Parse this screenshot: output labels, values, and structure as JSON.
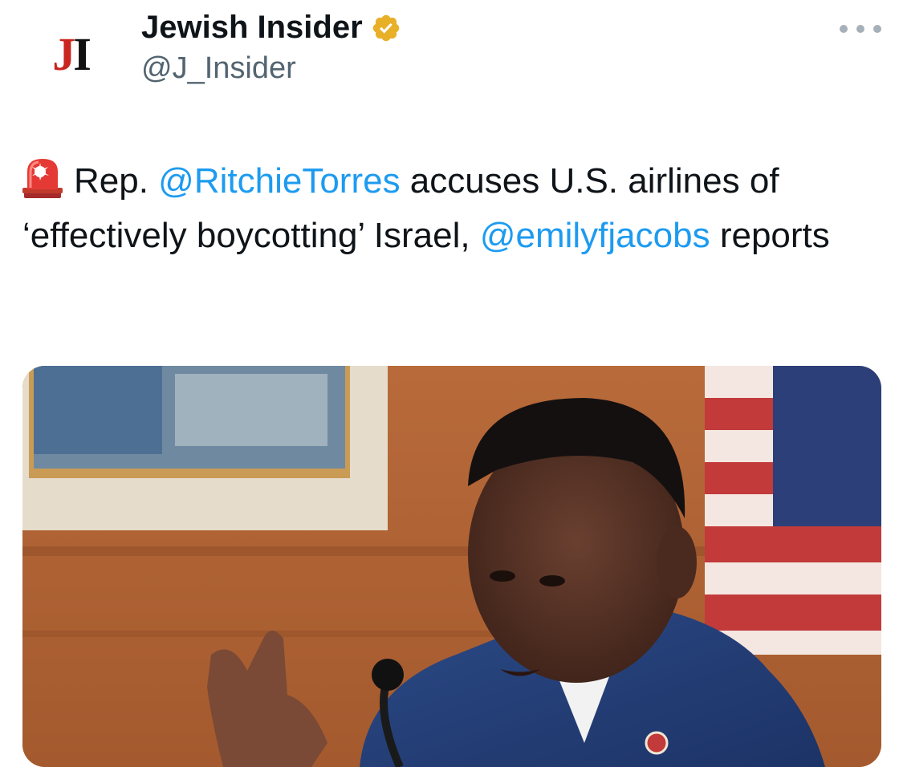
{
  "account": {
    "display_name": "Jewish Insider",
    "handle": "@J_Insider",
    "avatar_logo": {
      "j": "J",
      "i": "I"
    },
    "verified": true,
    "verified_icon": "verified-badge-icon"
  },
  "header": {
    "more_icon": "more-options-icon"
  },
  "tweet": {
    "emoji_icon": "rotating-light-siren-icon",
    "segments": {
      "s1": "Rep. ",
      "m1": "@RitchieTorres",
      "s2": " accuses U.S. airlines of ‘effectively boycotting’ Israel, ",
      "m2": "@emilyfjacobs",
      "s3": " reports"
    }
  },
  "media": {
    "type": "photo",
    "subject": "man in blue suit speaking at hearing microphone with U.S. flag behind"
  },
  "colors": {
    "mention": "#1d9bf0",
    "text": "#0f1419",
    "secondary": "#536471",
    "verified_gold": "#e8b027",
    "logo_red": "#c8261e"
  }
}
